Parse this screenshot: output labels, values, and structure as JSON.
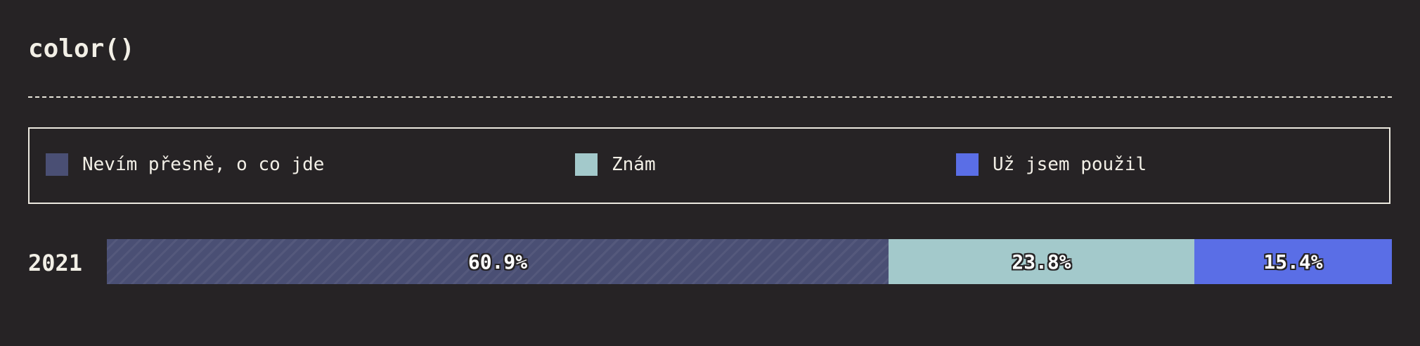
{
  "title": "color()",
  "legend": [
    {
      "label": "Nevím přesně, o co jde",
      "color": "#4a4f74"
    },
    {
      "label": "Znám",
      "color": "#a3c9cb"
    },
    {
      "label": "Už jsem použil",
      "color": "#5a6ee6"
    }
  ],
  "chart_data": {
    "type": "bar",
    "orientation": "horizontal-stacked",
    "categories": [
      "2021"
    ],
    "series": [
      {
        "name": "Nevím přesně, o co jde",
        "values": [
          60.9
        ],
        "label": "60.9%",
        "color": "#4a4f74"
      },
      {
        "name": "Znám",
        "values": [
          23.8
        ],
        "label": "23.8%",
        "color": "#a3c9cb"
      },
      {
        "name": "Už jsem použil",
        "values": [
          15.4
        ],
        "label": "15.4%",
        "color": "#5a6ee6"
      }
    ],
    "unit": "%",
    "legend_position": "top"
  }
}
